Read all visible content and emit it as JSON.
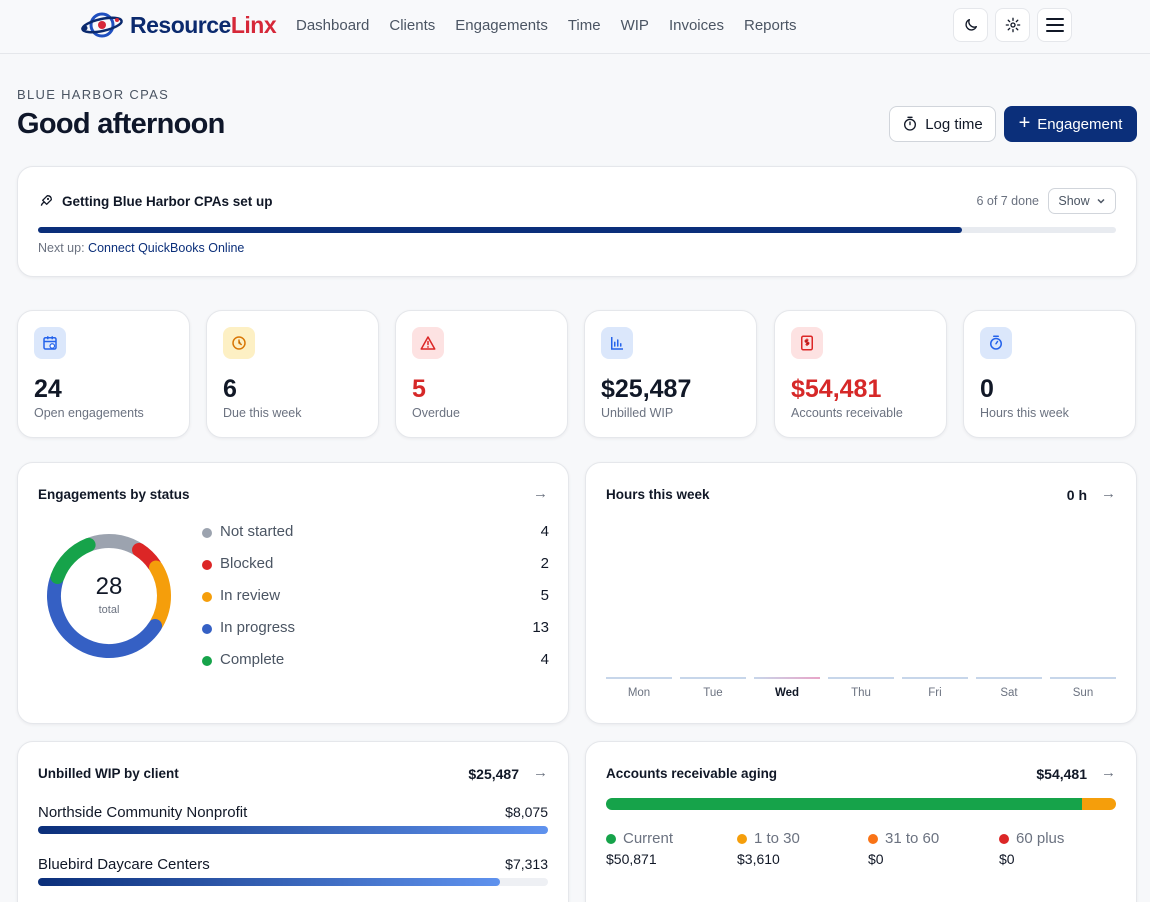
{
  "brand": {
    "name_a": "Resource",
    "name_b": "Linx"
  },
  "nav": [
    "Dashboard",
    "Clients",
    "Engagements",
    "Time",
    "WIP",
    "Invoices",
    "Reports"
  ],
  "header": {
    "org": "BLUE HARBOR CPAS",
    "greeting": "Good afternoon",
    "log_time_label": "Log time",
    "engagement_label": "Engagement"
  },
  "setup": {
    "title": "Getting Blue Harbor CPAs set up",
    "count": "6 of 7 done",
    "progress": 0.857,
    "show_label": "Show",
    "next_prefix": "Next up:",
    "next_link": "Connect QuickBooks Online"
  },
  "kpis": [
    {
      "value": "24",
      "label": "Open engagements",
      "icon": "calendar-clock-icon",
      "color": "#111827"
    },
    {
      "value": "6",
      "label": "Due this week",
      "icon": "clock-icon",
      "color": "#111827"
    },
    {
      "value": "5",
      "label": "Overdue",
      "icon": "alert-triangle-icon",
      "color": "#d62828"
    },
    {
      "value": "$25,487",
      "label": "Unbilled WIP",
      "icon": "bar-chart-icon",
      "color": "#111827"
    },
    {
      "value": "$54,481",
      "label": "Accounts receivable",
      "icon": "invoice-dollar-icon",
      "color": "#d62828"
    },
    {
      "value": "0",
      "label": "Hours this week",
      "icon": "stopwatch-icon",
      "color": "#111827"
    }
  ],
  "status_panel": {
    "title": "Engagements by status",
    "total": "28",
    "total_label": "total",
    "items": [
      {
        "name": "Not started",
        "value": 4,
        "color": "#9ca3af"
      },
      {
        "name": "Blocked",
        "value": 2,
        "color": "#dc2626"
      },
      {
        "name": "In review",
        "value": 5,
        "color": "#f59e0b"
      },
      {
        "name": "In progress",
        "value": 13,
        "color": "#3560c4"
      },
      {
        "name": "Complete",
        "value": 4,
        "color": "#16a34a"
      }
    ]
  },
  "hours_panel": {
    "title": "Hours this week",
    "total": "0 h",
    "days": [
      "Mon",
      "Tue",
      "Wed",
      "Thu",
      "Fri",
      "Sat",
      "Sun"
    ],
    "today": "Wed"
  },
  "wip_panel": {
    "title": "Unbilled WIP by client",
    "total": "$25,487",
    "rows": [
      {
        "name": "Northside Community Nonprofit",
        "value": "$8,075",
        "fraction": 1.0
      },
      {
        "name": "Bluebird Daycare Centers",
        "value": "$7,313",
        "fraction": 0.906
      }
    ]
  },
  "ar_panel": {
    "title": "Accounts receivable aging",
    "total": "$54,481",
    "buckets": [
      {
        "name": "Current",
        "value": "$50,871",
        "amount": 50871,
        "color": "#16a34a"
      },
      {
        "name": "1 to 30",
        "value": "$3,610",
        "amount": 3610,
        "color": "#f59e0b"
      },
      {
        "name": "31 to 60",
        "value": "$0",
        "amount": 0,
        "color": "#f97316"
      },
      {
        "name": "60 plus",
        "value": "$0",
        "amount": 0,
        "color": "#dc2626"
      }
    ]
  }
}
